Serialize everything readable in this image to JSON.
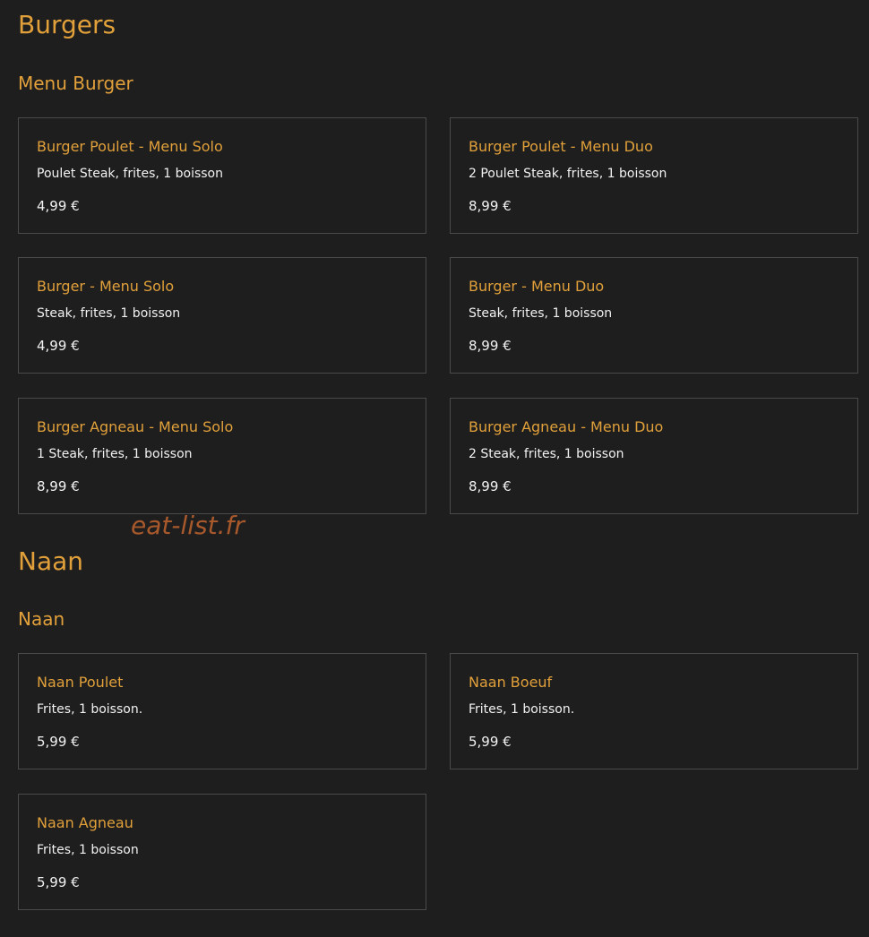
{
  "sections": [
    {
      "title": "Burgers",
      "subsection": "Menu Burger",
      "items": [
        {
          "name": "Burger Poulet - Menu Solo",
          "desc": "Poulet Steak, frites, 1 boisson",
          "price": "4,99 €"
        },
        {
          "name": "Burger Poulet - Menu Duo",
          "desc": "2 Poulet Steak, frites, 1 boisson",
          "price": "8,99 €"
        },
        {
          "name": "Burger - Menu Solo",
          "desc": "Steak, frites, 1 boisson",
          "price": "4,99 €"
        },
        {
          "name": "Burger - Menu Duo",
          "desc": "Steak, frites, 1 boisson",
          "price": "8,99 €"
        },
        {
          "name": "Burger Agneau - Menu Solo",
          "desc": "1 Steak, frites, 1 boisson",
          "price": "8,99 €"
        },
        {
          "name": "Burger Agneau - Menu Duo",
          "desc": "2 Steak, frites, 1 boisson",
          "price": "8,99 €"
        }
      ]
    },
    {
      "title": "Naan",
      "subsection": "Naan",
      "items": [
        {
          "name": "Naan Poulet",
          "desc": "Frites, 1 boisson.",
          "price": "5,99 €"
        },
        {
          "name": "Naan Boeuf",
          "desc": "Frites, 1 boisson.",
          "price": "5,99 €"
        },
        {
          "name": "Naan Agneau",
          "desc": "Frites, 1 boisson",
          "price": "5,99 €"
        }
      ]
    }
  ],
  "watermark": "eat-list.fr",
  "colors": {
    "background": "#1e1e1e",
    "accent": "#e1a03a",
    "text": "#f2f2f2",
    "card_border": "#4a4a4a",
    "watermark": "#b8602e"
  }
}
